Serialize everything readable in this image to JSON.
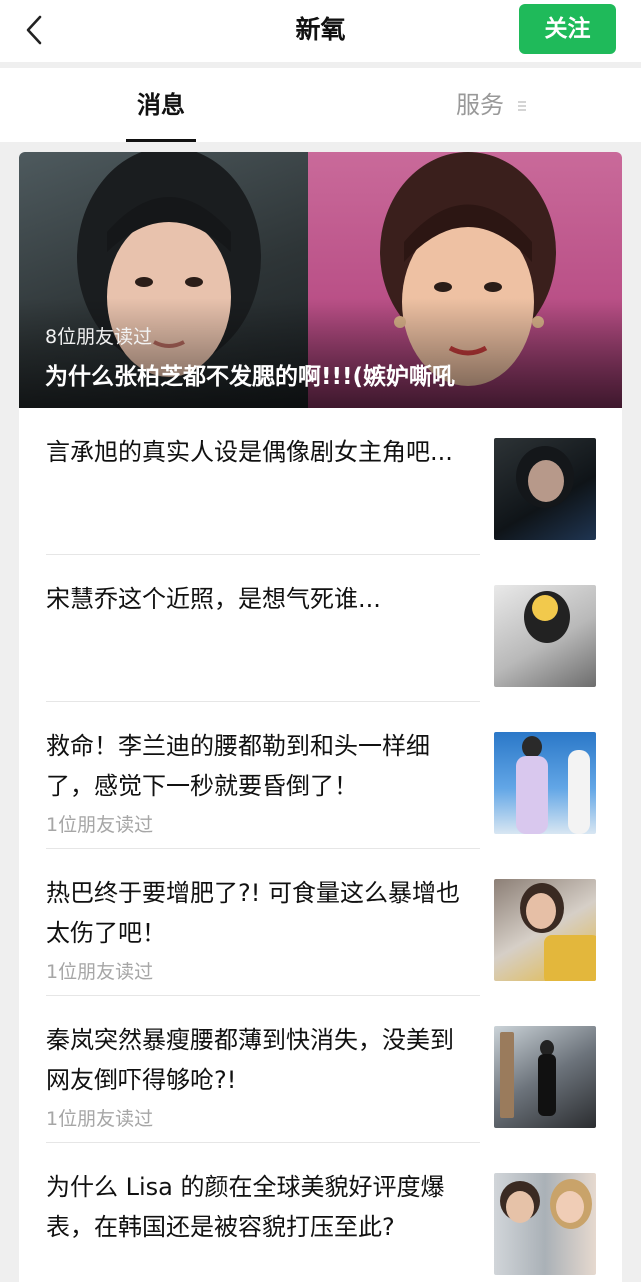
{
  "header": {
    "back_icon": "chevron-left-icon",
    "title": "新氧",
    "follow_label": "关注",
    "accent_color": "#1fba5a"
  },
  "tabs": [
    {
      "label": "消息",
      "active": true
    },
    {
      "label": "服务",
      "active": false,
      "icon": "menu-icon"
    }
  ],
  "featured": {
    "meta": "8位朋友读过",
    "title": "为什么张柏芝都不发腮的啊!!!(嫉妒嘶吼"
  },
  "articles": [
    {
      "title": "言承旭的真实人设是偶像剧女主角吧...",
      "meta": ""
    },
    {
      "title": "宋慧乔这个近照，是想气死谁...",
      "meta": ""
    },
    {
      "title": "救命！李兰迪的腰都勒到和头一样细了，感觉下一秒就要昏倒了！",
      "meta": "1位朋友读过"
    },
    {
      "title": "热巴终于要增肥了?! 可食量这么暴增也太伤了吧！",
      "meta": "1位朋友读过"
    },
    {
      "title": "秦岚突然暴瘦腰都薄到快消失，没美到网友倒吓得够呛?!",
      "meta": "1位朋友读过"
    },
    {
      "title": "为什么 Lisa 的颜在全球美貌好评度爆表，在韩国还是被容貌打压至此?",
      "meta": ""
    }
  ]
}
